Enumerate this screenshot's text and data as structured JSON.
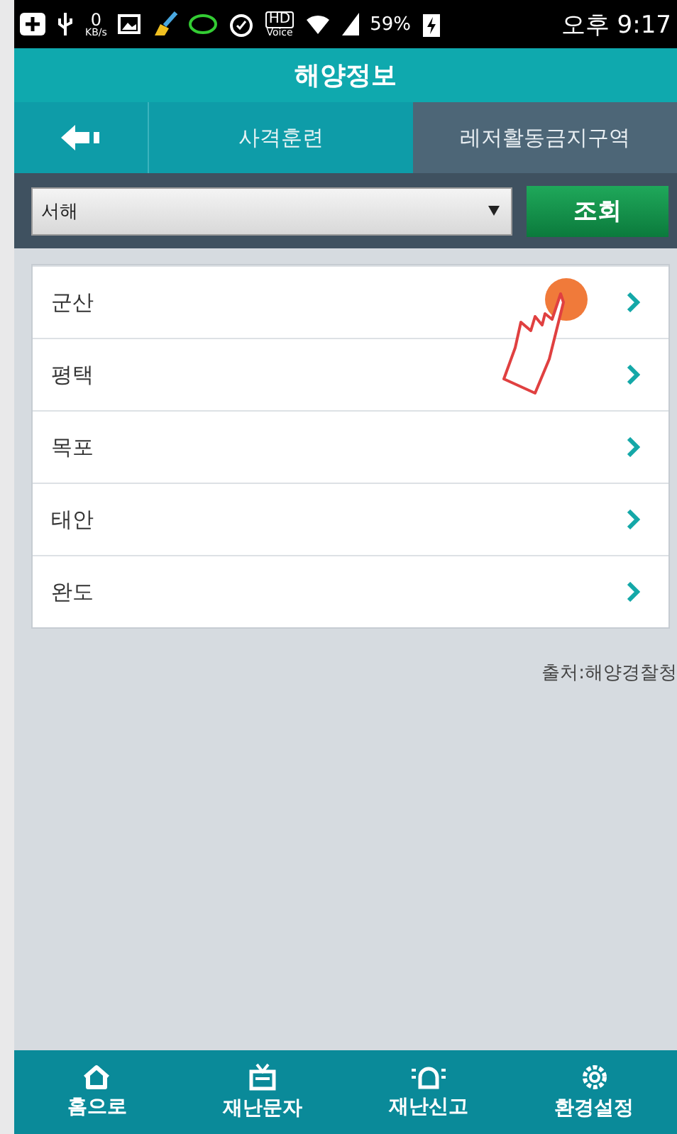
{
  "status_bar": {
    "speed_value": "0",
    "speed_unit": "KB/s",
    "hd": "HD",
    "voice": "Voice",
    "battery": "59%",
    "time": "오후 9:17"
  },
  "title": "해양정보",
  "tabs": [
    {
      "label": "사격훈련",
      "selected": false
    },
    {
      "label": "레저활동금지구역",
      "selected": true
    }
  ],
  "filter": {
    "region": "서해",
    "button": "조회"
  },
  "list": [
    {
      "label": "군산",
      "touched": true
    },
    {
      "label": "평택",
      "touched": false
    },
    {
      "label": "목포",
      "touched": false
    },
    {
      "label": "태안",
      "touched": false
    },
    {
      "label": "완도",
      "touched": false
    }
  ],
  "source": "출처:해양경찰청",
  "bottom_nav": [
    {
      "kind": "home",
      "label": "홈으로"
    },
    {
      "kind": "tv",
      "label": "재난문자"
    },
    {
      "kind": "siren",
      "label": "재난신고"
    },
    {
      "kind": "gear",
      "label": "환경설정"
    }
  ]
}
